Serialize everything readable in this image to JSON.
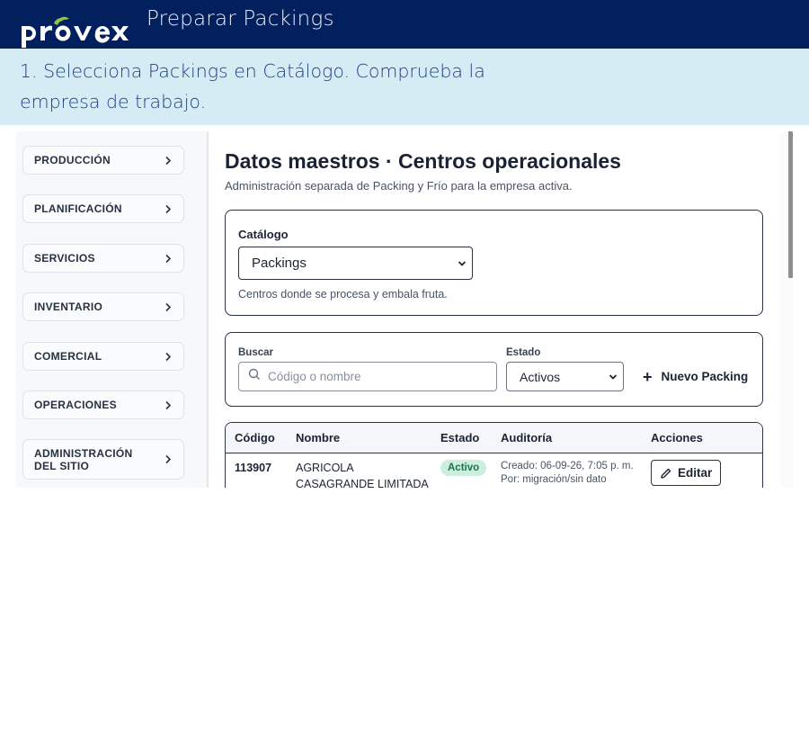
{
  "header": {
    "logo_text": "provex",
    "title": "Preparar Packings"
  },
  "instruction": {
    "text": "1. Selecciona Packings en Catálogo. Comprueba la empresa de trabajo."
  },
  "sidebar": {
    "items": [
      {
        "label": "PRODUCCIÓN"
      },
      {
        "label": "PLANIFICACIÓN"
      },
      {
        "label": "SERVICIOS"
      },
      {
        "label": "INVENTARIO"
      },
      {
        "label": "COMERCIAL"
      },
      {
        "label": "OPERACIONES"
      },
      {
        "label": "ADMINISTRACIÓN DEL SITIO"
      }
    ]
  },
  "main": {
    "title": "Datos maestros · Centros operacionales",
    "subtitle": "Administración separada de Packing y Frío para la empresa activa.",
    "catalog": {
      "label": "Catálogo",
      "selected": "Packings",
      "hint": "Centros donde se procesa y embala fruta."
    },
    "filters": {
      "search_label": "Buscar",
      "search_placeholder": "Código o nombre",
      "status_label": "Estado",
      "status_selected": "Activos",
      "new_button": "Nuevo Packing"
    },
    "table": {
      "columns": [
        "Código",
        "Nombre",
        "Estado",
        "Auditoría",
        "Acciones"
      ],
      "rows": [
        {
          "code": "113907",
          "name": "AGRICOLA CASAGRANDE LIMITADA",
          "status": "Activo",
          "audit_created": "Creado: 06-09-26, 7:05 p. m.",
          "audit_by": "Por: migración/sin dato",
          "action": "Editar"
        }
      ]
    }
  },
  "colors": {
    "header_bg": "#03205e",
    "instruction_bg": "#d6ecf5",
    "badge_bg": "#cdeede",
    "badge_text": "#17744a"
  },
  "icons": [
    "chevron-right-icon",
    "search-icon",
    "plus-icon",
    "pencil-icon",
    "dropdown-arrow-icon"
  ]
}
